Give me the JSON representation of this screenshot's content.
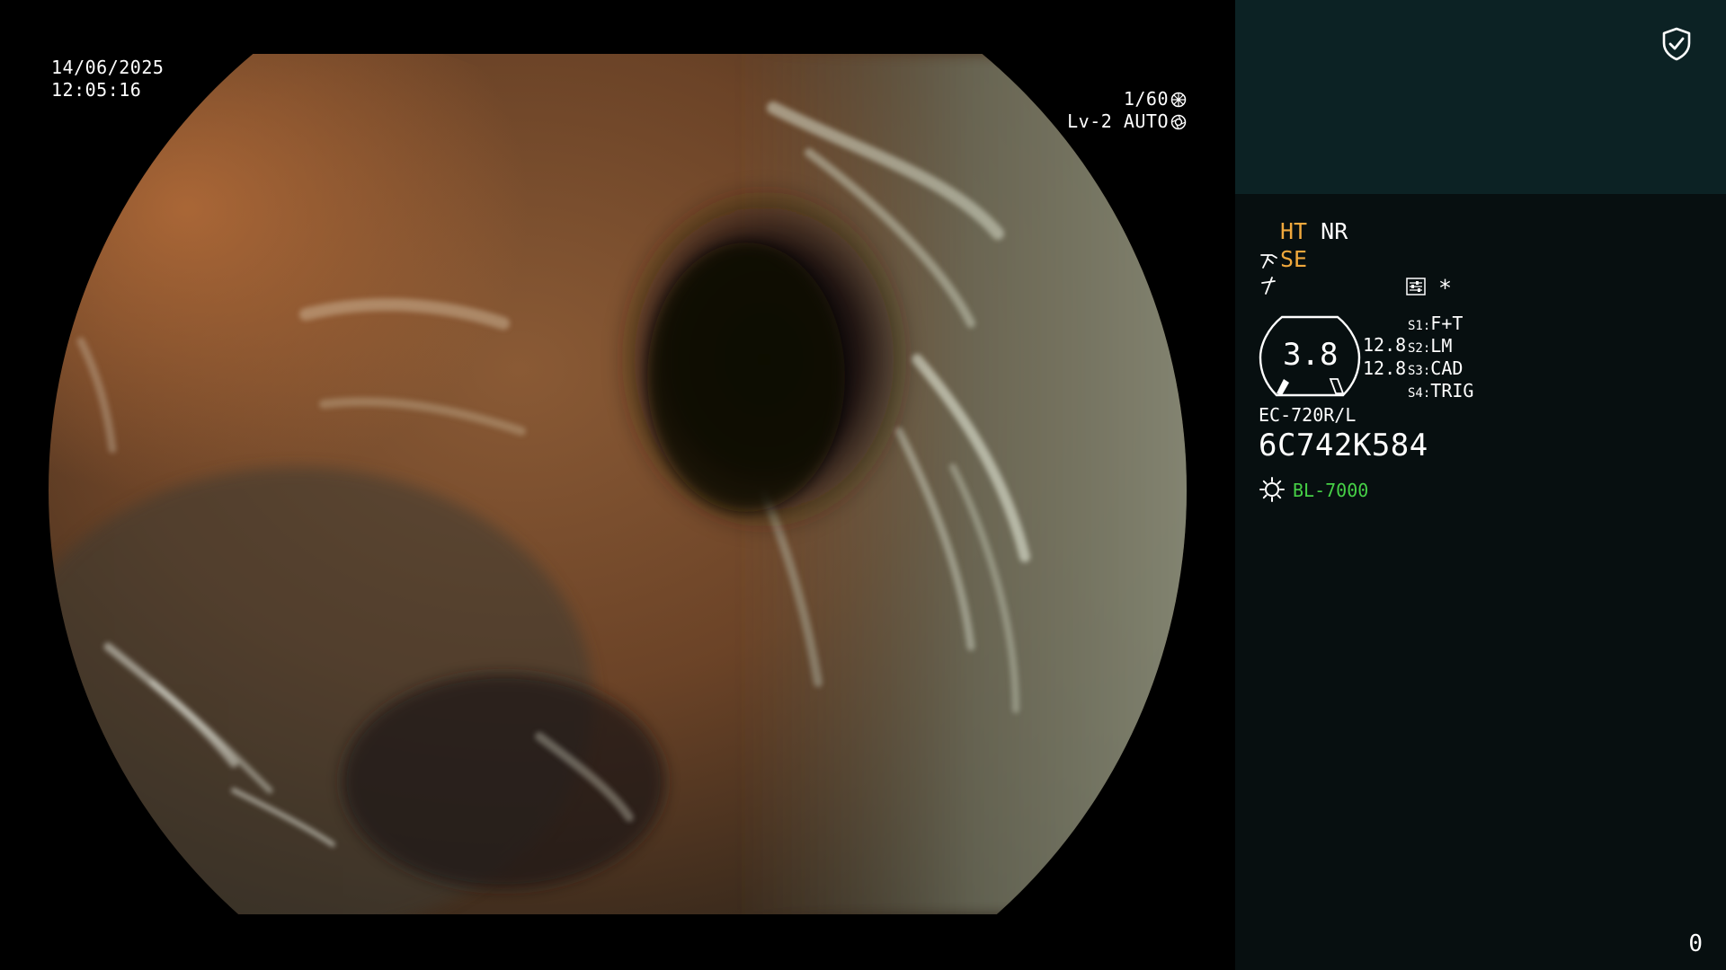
{
  "osd": {
    "date": "14/06/2025",
    "time": "12:05:16",
    "shutter": "1/60",
    "level": "Lv-2",
    "iris": "AUTO"
  },
  "panel": {
    "ht": "HT",
    "nr": "NR",
    "se": "SE",
    "asterisk": "*",
    "zoom_value": "3.8",
    "val_upper": "12.8",
    "val_lower": "12.8",
    "switches": [
      {
        "key": "S1:",
        "value": "F+T"
      },
      {
        "key": "S2:",
        "value": "LM"
      },
      {
        "key": "S3:",
        "value": "CAD"
      },
      {
        "key": "S4:",
        "value": "TRIG"
      }
    ],
    "scope_model": "EC-720R/L",
    "serial": "6C742K584",
    "light_source": "BL-7000",
    "counter": "0"
  },
  "colors": {
    "panel_bg": "#070f10",
    "panel_top_bg": "#0c2224",
    "accent_orange": "#f0a83c",
    "accent_green": "#46d046"
  },
  "icons": [
    "shutter-icon",
    "iris-icon",
    "shield-check-icon",
    "hand-icon",
    "lightning-icon",
    "settings-panel-icon",
    "light-source-icon",
    "scope-tip-icon"
  ]
}
